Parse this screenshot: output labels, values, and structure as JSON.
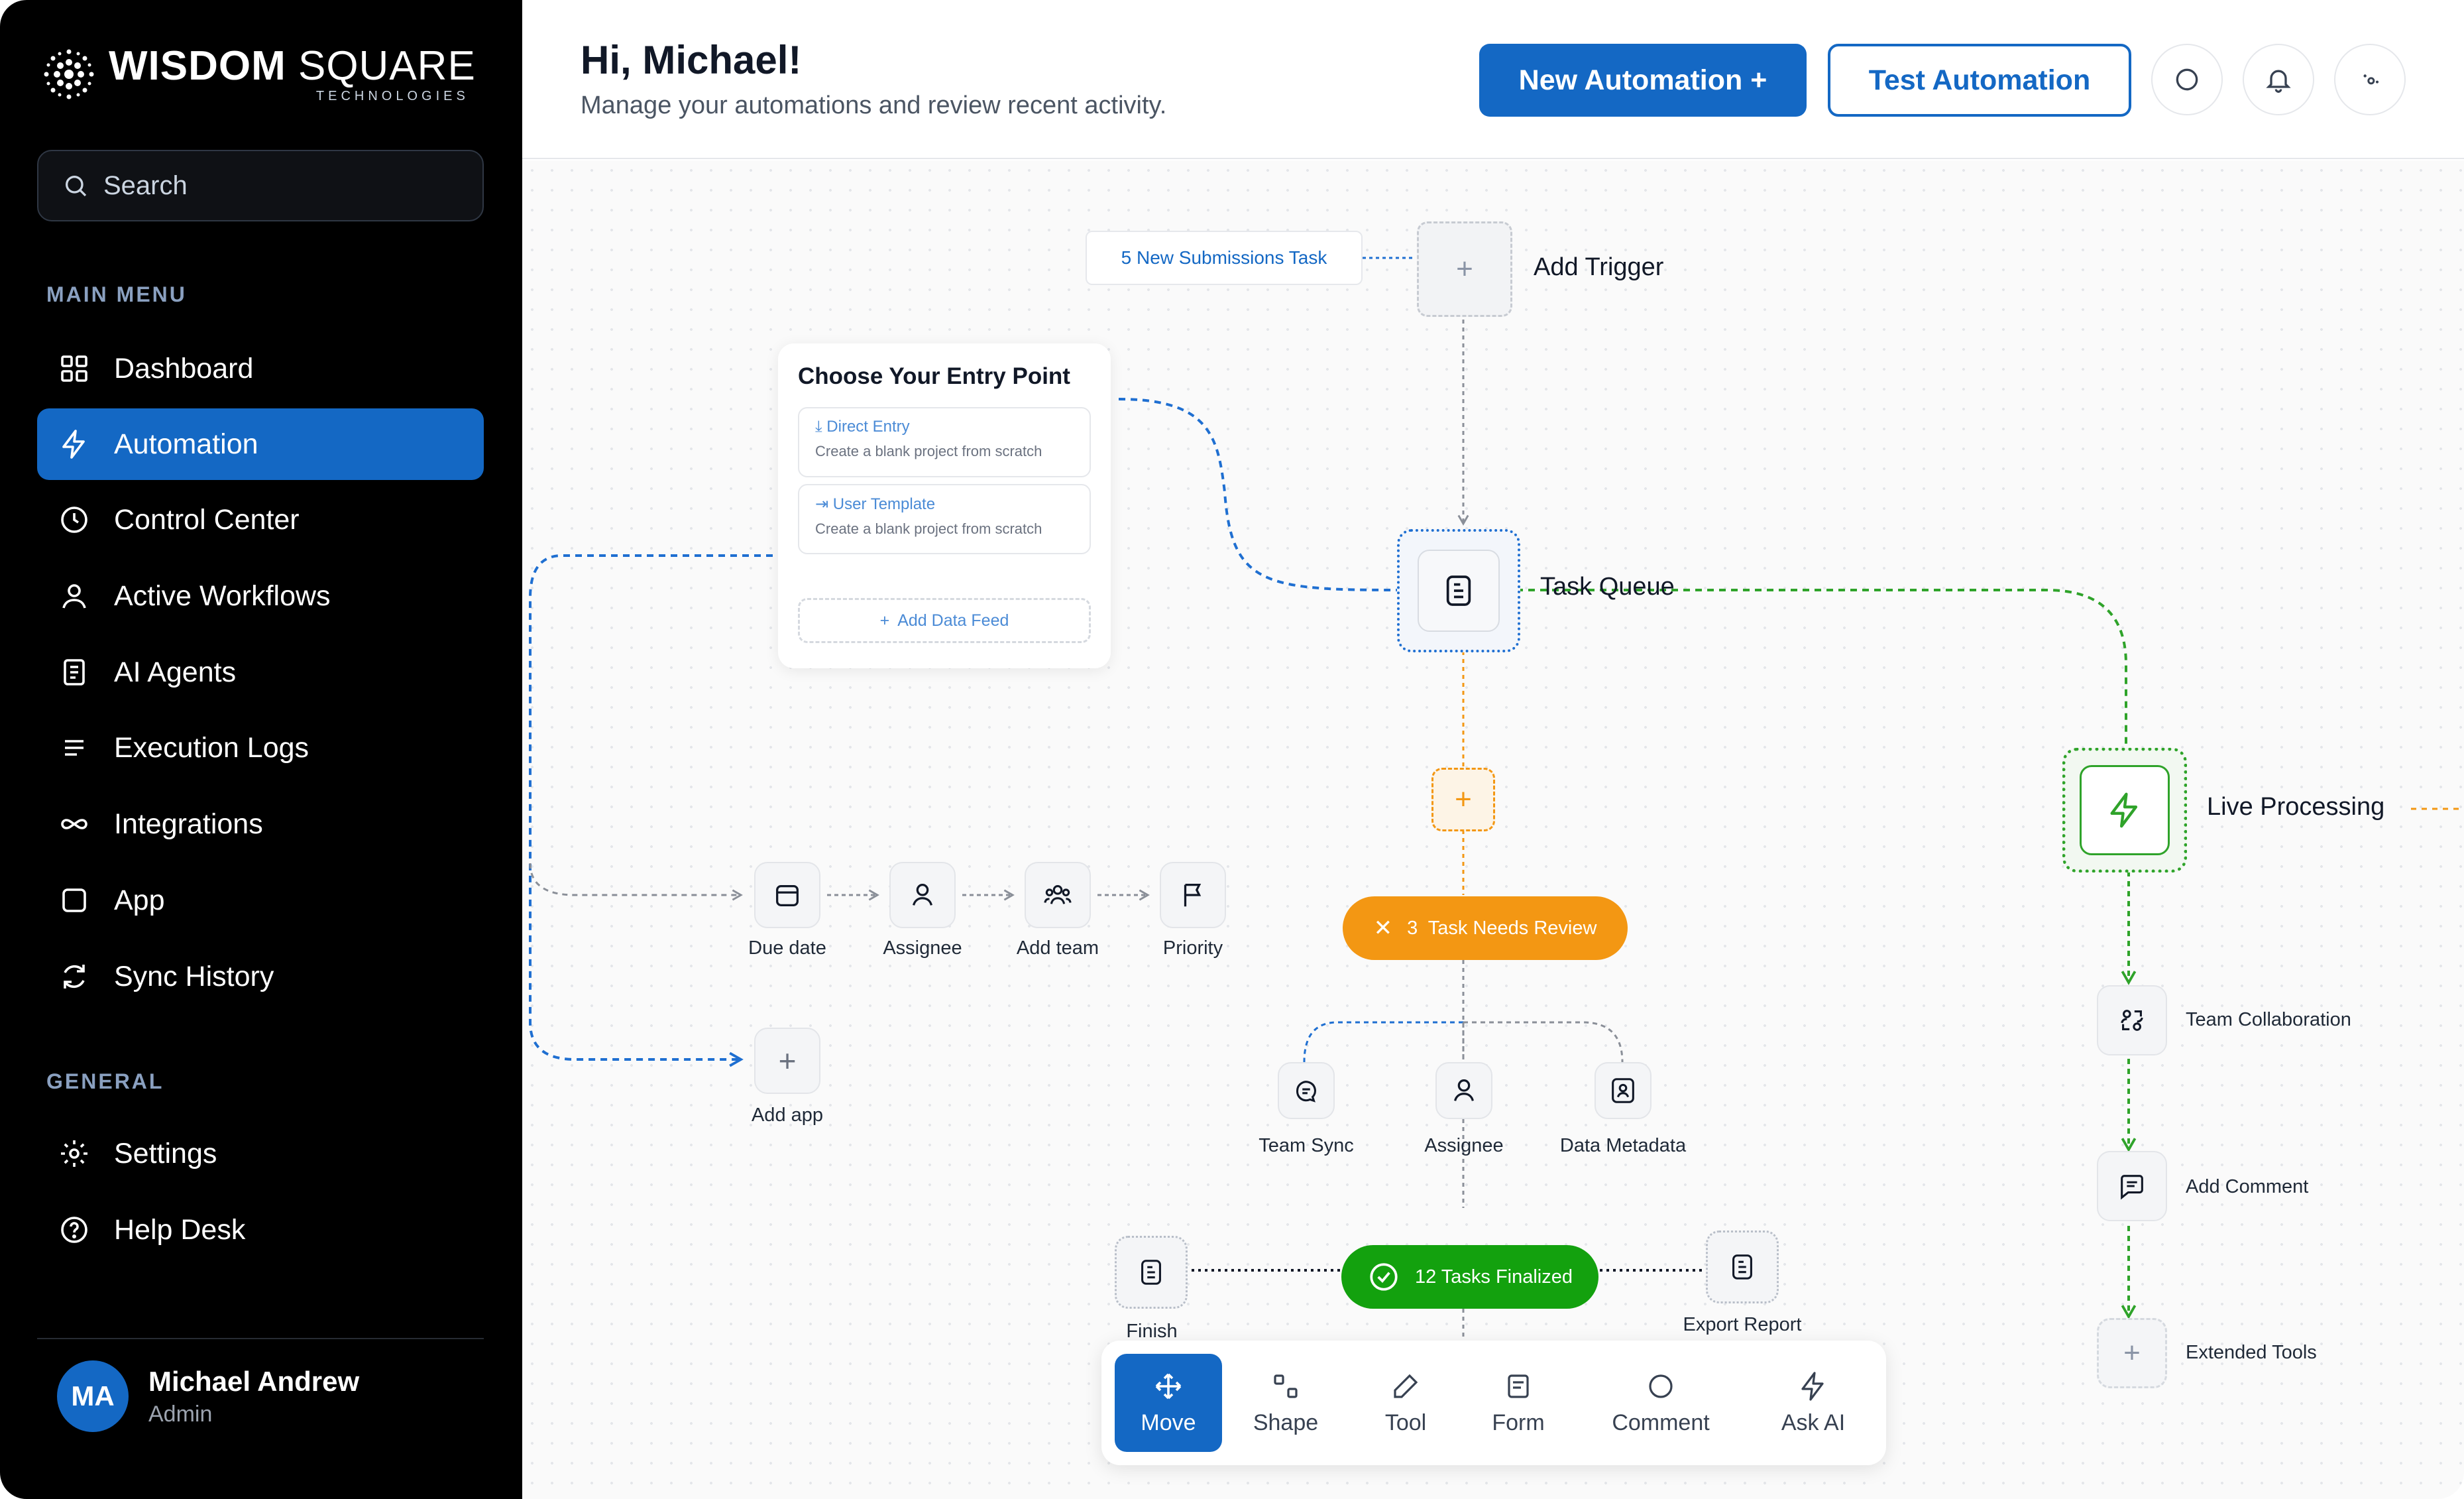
{
  "brand": {
    "word_bold": "WISDOM",
    "word_light": " SQUARE",
    "sub": "TECHNOLOGIES"
  },
  "sidebar": {
    "search_placeholder": "Search",
    "main_menu_label": "MAIN MENU",
    "items": [
      {
        "label": "Dashboard",
        "icon": "grid-icon"
      },
      {
        "label": "Automation",
        "icon": "lightning-icon",
        "active": true
      },
      {
        "label": "Control Center",
        "icon": "clock-icon"
      },
      {
        "label": "Active Workflows",
        "icon": "user-icon"
      },
      {
        "label": "AI Agents",
        "icon": "document-icon"
      },
      {
        "label": "Execution Logs",
        "icon": "lines-icon"
      },
      {
        "label": "Integrations",
        "icon": "infinity-icon"
      },
      {
        "label": "App",
        "icon": "square-icon"
      },
      {
        "label": "Sync History",
        "icon": "sync-icon"
      }
    ],
    "general_label": "GENERAL",
    "general_items": [
      {
        "label": "Settings",
        "icon": "gear-icon"
      },
      {
        "label": "Help Desk",
        "icon": "help-icon"
      }
    ],
    "user": {
      "initials": "MA",
      "name": "Michael Andrew",
      "role": "Admin"
    }
  },
  "header": {
    "greeting": "Hi, Michael!",
    "subtitle": "Manage your automations and review recent activity.",
    "new_automation": "New Automation +",
    "test_automation": "Test Automation"
  },
  "canvas": {
    "chip": "5 New Submissions Task",
    "add_trigger": "Add Trigger",
    "task_queue": "Task Queue",
    "live_processing": "Live Processing",
    "entry_card": {
      "title": "Choose Your Entry Point",
      "options": [
        {
          "title": "Direct Entry",
          "desc": "Create a blank project from scratch"
        },
        {
          "title": "User Template",
          "desc": "Create a blank project from scratch"
        }
      ],
      "add_feed": "Add Data Feed"
    },
    "row_nodes": [
      "Due date",
      "Assignee",
      "Add team",
      "Priority"
    ],
    "add_app": "Add app",
    "review_pill": "3  Task Needs Review",
    "sub_nodes": [
      "Team Sync",
      "Assignee",
      "Data Metadata"
    ],
    "finalized_pill": "12 Tasks Finalized",
    "finish": "Finish",
    "export_report": "Export Report",
    "right_nodes": [
      "Team Collaboration",
      "Add Comment",
      "Extended Tools"
    ]
  },
  "toolbar": {
    "tools": [
      "Move",
      "Shape",
      "Tool",
      "Form",
      "Comment",
      "Ask AI"
    ]
  },
  "colors": {
    "accent": "#1468c4",
    "orange": "#f39713",
    "green": "#13a10e",
    "sidebar": "#000000"
  }
}
